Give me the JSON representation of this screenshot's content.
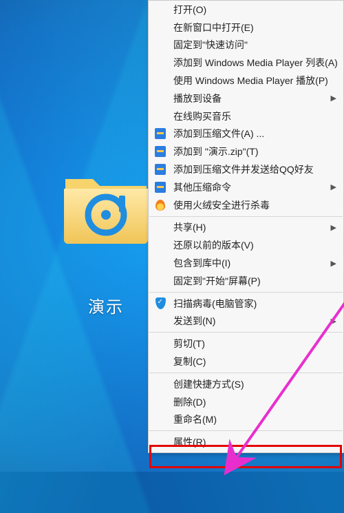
{
  "folder": {
    "label": "演示",
    "icon_name": "music-folder"
  },
  "menu": {
    "groups": [
      {
        "items": [
          {
            "label": "打开(O)",
            "icon": "",
            "submenu": false
          },
          {
            "label": "在新窗口中打开(E)",
            "icon": "",
            "submenu": false
          },
          {
            "label": "固定到\"快速访问\"",
            "icon": "",
            "submenu": false
          },
          {
            "label": "添加到 Windows Media Player 列表(A)",
            "icon": "",
            "submenu": false
          },
          {
            "label": "使用 Windows Media Player 播放(P)",
            "icon": "",
            "submenu": false
          },
          {
            "label": "播放到设备",
            "icon": "",
            "submenu": true
          },
          {
            "label": "在线购买音乐",
            "icon": "",
            "submenu": false
          },
          {
            "label": "添加到压缩文件(A) ...",
            "icon": "archive",
            "submenu": false
          },
          {
            "label": "添加到 \"演示.zip\"(T)",
            "icon": "archive",
            "submenu": false
          },
          {
            "label": "添加到压缩文件并发送给QQ好友",
            "icon": "archive",
            "submenu": false
          },
          {
            "label": "其他压缩命令",
            "icon": "archive",
            "submenu": true
          },
          {
            "label": "使用火绒安全进行杀毒",
            "icon": "fire",
            "submenu": false
          }
        ]
      },
      {
        "items": [
          {
            "label": "共享(H)",
            "icon": "",
            "submenu": true
          },
          {
            "label": "还原以前的版本(V)",
            "icon": "",
            "submenu": false
          },
          {
            "label": "包含到库中(I)",
            "icon": "",
            "submenu": true
          },
          {
            "label": "固定到\"开始\"屏幕(P)",
            "icon": "",
            "submenu": false
          }
        ]
      },
      {
        "items": [
          {
            "label": "扫描病毒(电脑管家)",
            "icon": "shield",
            "submenu": false
          },
          {
            "label": "发送到(N)",
            "icon": "",
            "submenu": true
          }
        ]
      },
      {
        "items": [
          {
            "label": "剪切(T)",
            "icon": "",
            "submenu": false
          },
          {
            "label": "复制(C)",
            "icon": "",
            "submenu": false
          }
        ]
      },
      {
        "items": [
          {
            "label": "创建快捷方式(S)",
            "icon": "",
            "submenu": false
          },
          {
            "label": "删除(D)",
            "icon": "",
            "submenu": false
          },
          {
            "label": "重命名(M)",
            "icon": "",
            "submenu": false
          }
        ]
      },
      {
        "items": [
          {
            "label": "属性(R)",
            "icon": "",
            "submenu": false
          }
        ]
      }
    ]
  },
  "annotation": {
    "highlighted_item": "属性(R)",
    "arrow_color": "#e82fce"
  }
}
